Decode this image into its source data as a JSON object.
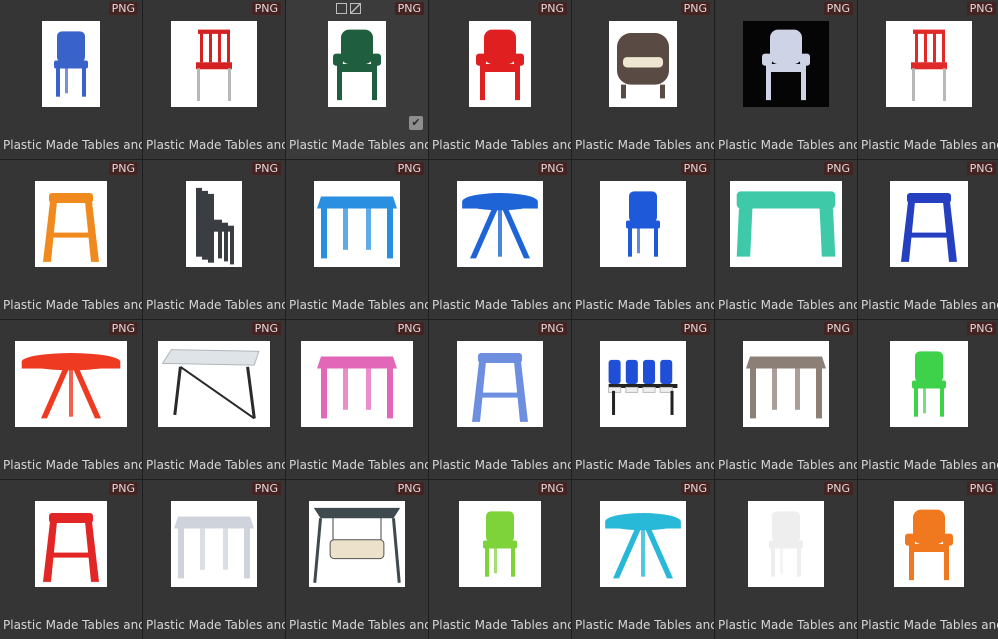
{
  "badge": "PNG",
  "caption": "Plastic Made Tables and ...",
  "colors": {
    "background": "#1e1e1e",
    "tile": "#353535",
    "badge": "#452323"
  },
  "selected_tile": 2,
  "tiles": [
    {
      "type": "chair",
      "color": "#3a63c9"
    },
    {
      "type": "chair-metal",
      "color": "#d42222"
    },
    {
      "type": "armchair",
      "color": "#1f5e3f"
    },
    {
      "type": "armchair",
      "color": "#e02020"
    },
    {
      "type": "lounge",
      "color": "#5a4a44"
    },
    {
      "type": "armchair",
      "color": "#cfd3e6",
      "dark": true
    },
    {
      "type": "chair-metal",
      "color": "#e02a2a"
    },
    {
      "type": "stool",
      "color": "#f08a1e"
    },
    {
      "type": "stack",
      "color": "#3a3d42"
    },
    {
      "type": "table-square",
      "color": "#2a8fe0"
    },
    {
      "type": "table-round",
      "color": "#1e64d6"
    },
    {
      "type": "chair",
      "color": "#1d59d8"
    },
    {
      "type": "table-rect",
      "color": "#3ec9a8"
    },
    {
      "type": "stool",
      "color": "#2440c0"
    },
    {
      "type": "table-round",
      "color": "#ee3a20"
    },
    {
      "type": "table-fold",
      "color": "#dfe4e8"
    },
    {
      "type": "table-square",
      "color": "#e367b8"
    },
    {
      "type": "stool",
      "color": "#6e8fe0"
    },
    {
      "type": "bench",
      "color": "#1f4fd6"
    },
    {
      "type": "table-square",
      "color": "#8c7f76"
    },
    {
      "type": "chair",
      "color": "#3ed24a"
    },
    {
      "type": "stool",
      "color": "#e22626"
    },
    {
      "type": "table-square",
      "color": "#cfd4dc"
    },
    {
      "type": "swing",
      "color": "#3e4a4e"
    },
    {
      "type": "chair",
      "color": "#7ed23a"
    },
    {
      "type": "table-round",
      "color": "#28b8d8"
    },
    {
      "type": "chair",
      "color": "#eeeeee"
    },
    {
      "type": "armchair",
      "color": "#f0781e"
    }
  ]
}
